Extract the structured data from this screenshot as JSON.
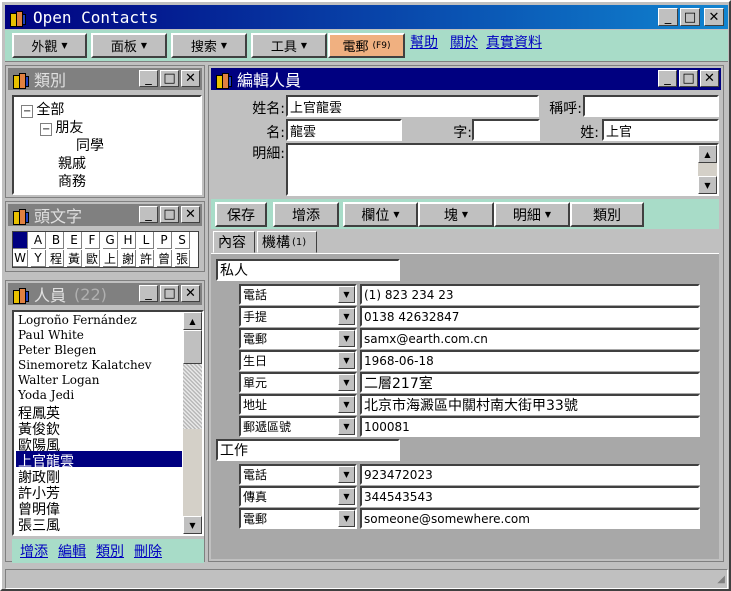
{
  "app": {
    "title": "Open Contacts"
  },
  "menu": {
    "buttons": [
      "外觀",
      "面板",
      "搜索",
      "工具"
    ],
    "email": "電郵",
    "email_key": "(F9)",
    "links": [
      "幫助",
      "關於",
      "真實資料"
    ]
  },
  "category_panel": {
    "title": "類別",
    "tree": [
      "全部",
      "朋友",
      "同學",
      "親戚",
      "商務"
    ]
  },
  "initials_panel": {
    "title": "頭文字",
    "row1": [
      "",
      "A",
      "B",
      "E",
      "F",
      "G",
      "H",
      "L",
      "P",
      "S"
    ],
    "row2": [
      "W",
      "Y",
      "程",
      "黃",
      "歐",
      "上",
      "謝",
      "許",
      "曾",
      "張"
    ]
  },
  "people_panel": {
    "title": "人員",
    "count": "(22)",
    "people": [
      "Logroño Fernández",
      "Paul White",
      "Peter Blegen",
      "Sinemoretz Kalatchev",
      "Walter Logan",
      "Yoda Jedi",
      "程鳳英",
      "黃俊欽",
      "歐陽風",
      "上官龍雲",
      "謝政剛",
      "許小芳",
      "曾明偉",
      "張三風"
    ],
    "selected_index": 9,
    "links": [
      "增添",
      "編輯",
      "類別",
      "刪除"
    ]
  },
  "editor": {
    "title": "編輯人員",
    "labels": {
      "full_name": "姓名:",
      "salutation": "稱呼:",
      "given": "名:",
      "courtesy": "字:",
      "family": "姓:",
      "notes": "明細:"
    },
    "values": {
      "full_name": "上官龍雲",
      "salutation": "",
      "given": "龍雲",
      "courtesy": "",
      "family": "上官",
      "notes": ""
    },
    "toolbar": {
      "save": "保存",
      "add": "增添",
      "fields": "欄位",
      "blocks": "塊",
      "details": "明細",
      "category": "類別"
    },
    "tabs": [
      "內容",
      "機構"
    ],
    "tab2_count": "(1)",
    "sections": [
      {
        "name": "私人",
        "rows": [
          {
            "type": "電話",
            "value": "(1) 823 234 23"
          },
          {
            "type": "手提",
            "value": "0138 42632847"
          },
          {
            "type": "電郵",
            "value": "samx@earth.com.cn"
          },
          {
            "type": "生日",
            "value": "1968-06-18"
          },
          {
            "type": "單元",
            "value": "二層217室"
          },
          {
            "type": "地址",
            "value": "北京市海澱區中關村南大街甲33號"
          },
          {
            "type": "郵遞區號",
            "value": "100081"
          }
        ]
      },
      {
        "name": "工作",
        "rows": [
          {
            "type": "電話",
            "value": "923472023"
          },
          {
            "type": "傳真",
            "value": "344543543"
          },
          {
            "type": "電郵",
            "value": "someone@somewhere.com"
          }
        ]
      }
    ]
  }
}
